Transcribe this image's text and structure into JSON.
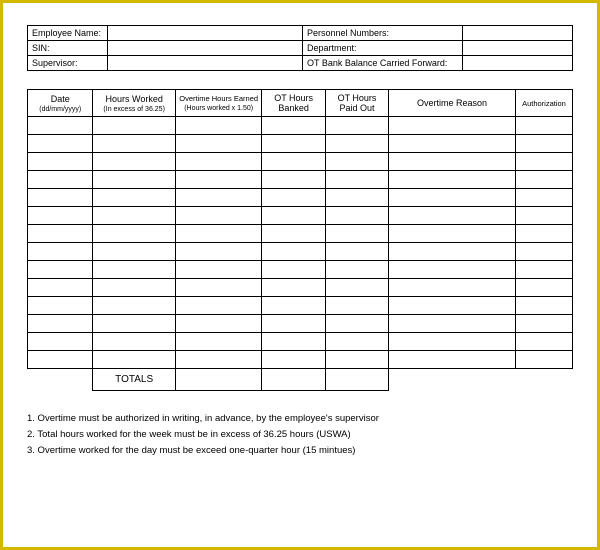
{
  "info": {
    "employee_name_label": "Employee Name:",
    "sin_label": "SIN:",
    "supervisor_label": "Supervisor:",
    "personnel_numbers_label": "Personnel Numbers:",
    "department_label": "Department:",
    "ot_bank_balance_label": "OT Bank Balance Carried Forward:",
    "employee_name": "",
    "sin": "",
    "supervisor": "",
    "personnel_numbers": "",
    "department": "",
    "ot_bank_balance": ""
  },
  "headers": {
    "date": "Date",
    "date_sub": "(dd/mm/yyyy)",
    "hours_worked": "Hours Worked",
    "hours_worked_sub": "(In excess of 36.25)",
    "ot_earned": "Overtime Hours Earned",
    "ot_earned_sub": "(Hours worked x 1.50)",
    "ot_banked": "OT Hours",
    "ot_banked_sub": "Banked",
    "ot_paid": "OT Hours",
    "ot_paid_sub": "Paid Out",
    "reason": "Overtime Reason",
    "auth": "Authorization"
  },
  "totals_label": "TOTALS",
  "notes": {
    "n1": "1. Overtime must be authorized in writing, in advance, by the employee's supervisor",
    "n2": "2. Total hours worked for the week must be in excess of 36.25 hours (USWA)",
    "n3": "3. Overtime worked for the day must be exceed one-quarter hour (15 mintues)"
  }
}
